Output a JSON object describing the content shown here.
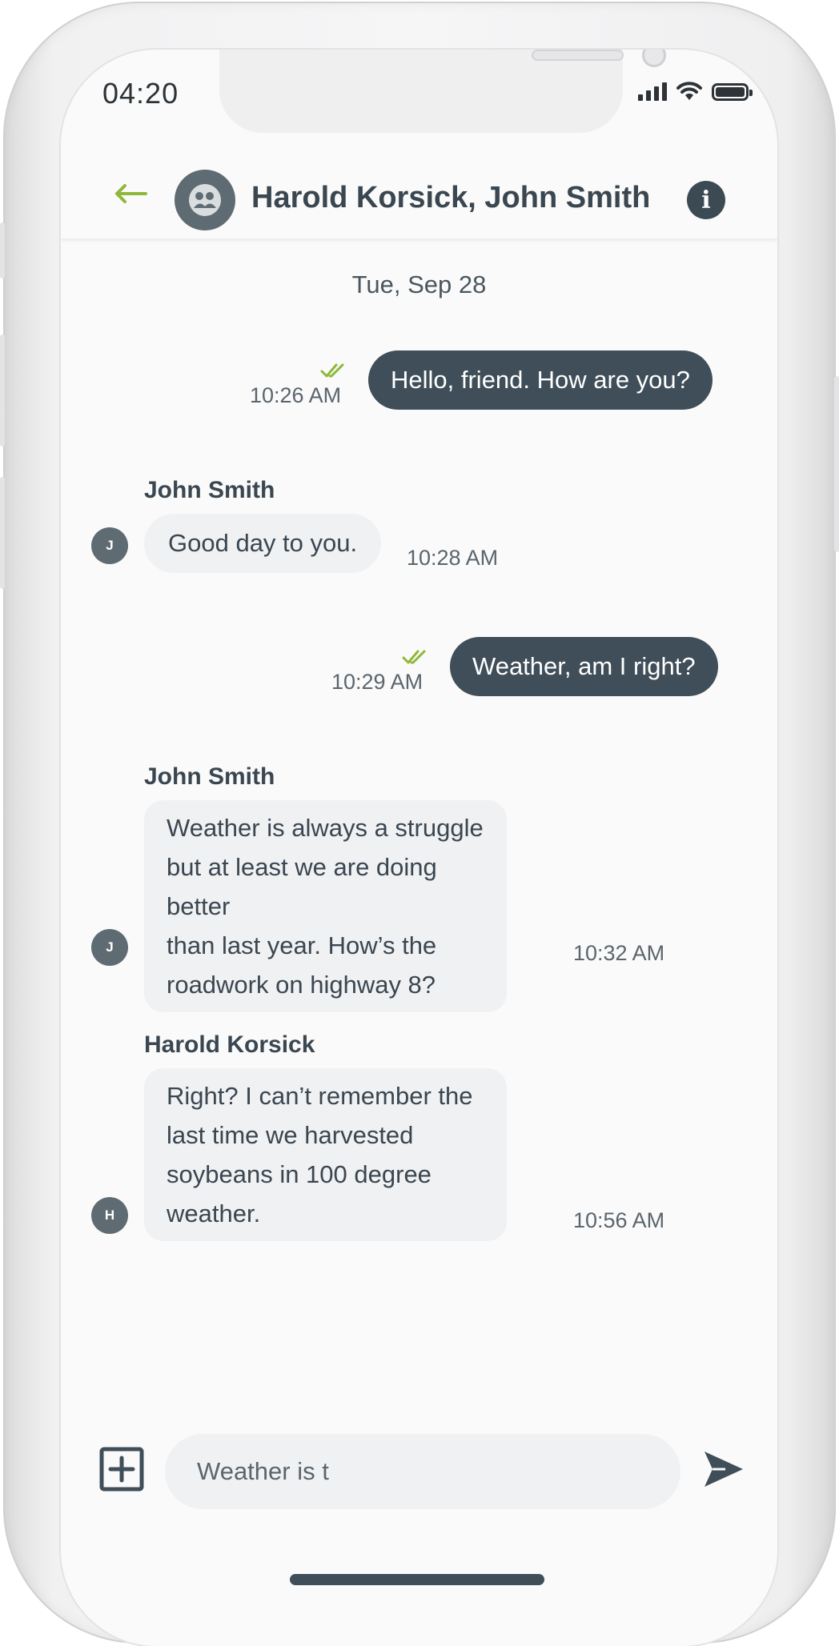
{
  "status_bar": {
    "time": "04:20"
  },
  "header": {
    "title": "Harold Korsick, John Smith",
    "back_icon": "arrow-left-icon",
    "avatar_icon": "group-icon",
    "info_icon": "info-icon",
    "info_label": "i"
  },
  "conversation": {
    "date": "Tue, Sep 28",
    "messages": [
      {
        "direction": "outgoing",
        "text": "Hello, friend. How are you?",
        "time": "10:26 AM",
        "read": true
      },
      {
        "direction": "incoming",
        "sender": "John Smith",
        "initial": "J",
        "text": "Good day to you.",
        "time": "10:28 AM"
      },
      {
        "direction": "outgoing",
        "text": "Weather, am I right?",
        "time": "10:29 AM",
        "read": true
      },
      {
        "direction": "incoming",
        "sender": "John Smith",
        "initial": "J",
        "lines": [
          "Weather is always a struggle",
          "but at least we are doing better",
          "than last year. How’s the",
          "roadwork on highway 8?"
        ],
        "time": "10:32 AM"
      },
      {
        "direction": "incoming",
        "sender": "Harold Korsick",
        "initial": "H",
        "lines": [
          "Right? I can’t remember the",
          "last time we harvested",
          "soybeans in 100 degree",
          "weather."
        ],
        "time": "10:56 AM"
      }
    ]
  },
  "composer": {
    "value": "Weather is t",
    "add_icon": "plus-square-icon",
    "send_icon": "send-icon"
  },
  "colors": {
    "accent_green": "#8fb83a",
    "bubble_outgoing": "#3f4e58",
    "bubble_incoming": "#f0f1f3",
    "text_dark": "#3a4650"
  }
}
